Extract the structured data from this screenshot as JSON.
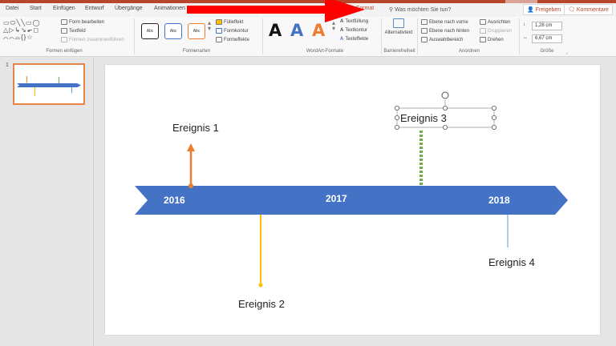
{
  "tabs": [
    {
      "label": "Datei",
      "active": false
    },
    {
      "label": "Start",
      "active": false
    },
    {
      "label": "Einfügen",
      "active": false
    },
    {
      "label": "Entwurf",
      "active": false
    },
    {
      "label": "Übergänge",
      "active": false
    },
    {
      "label": "Animationen",
      "active": false
    },
    {
      "label": "Format",
      "active": true
    }
  ],
  "search": {
    "placeholder": "Was möchten Sie tun?",
    "icon": "search-icon"
  },
  "share": {
    "label": "Freigeben",
    "icon": "share-icon"
  },
  "comments": {
    "label": "Kommentare",
    "icon": "comment-icon"
  },
  "ribbon": {
    "groups": {
      "insert_shapes": "Formen einfügen",
      "shape_styles": "Formenarten",
      "wordart": "WordArt-Formate",
      "accessibility": "Barrierefreiheit",
      "arrange": "Anordnen",
      "size": "Größe"
    },
    "insert_shapes": {
      "edit_shape": "Form bearbeiten",
      "textbox": "Textfeld",
      "merge_shapes": "Formen zusammenführen"
    },
    "shape_styles": {
      "fill": "Fülleffekt",
      "outline": "Formkontur",
      "effects": "Formeffekte",
      "style_label": "Abc"
    },
    "wordart": {
      "text_fill": "Textfüllung",
      "text_outline": "Textkontur",
      "text_effects": "Texteffekte",
      "letter": "A"
    },
    "accessibility": {
      "alt_text": "Alternativtext"
    },
    "arrange": {
      "bring_forward": "Ebene nach vorne",
      "send_backward": "Ebene nach hinten",
      "selection_pane": "Auswahlbereich",
      "align": "Ausrichten",
      "group": "Gruppieren",
      "rotate": "Drehen"
    },
    "size": {
      "height": "1,28 cm",
      "width": "6,67 cm"
    }
  },
  "thumbnail": {
    "number": "1"
  },
  "slide": {
    "years": [
      "2016",
      "2017",
      "2018"
    ],
    "events": [
      "Ereignis 1",
      "Ereignis 2",
      "Ereignis 3",
      "Ereignis 4"
    ]
  },
  "colors": {
    "accent": "#b7472a",
    "timeline_band": "#4472c4",
    "event1_line": "#ed7d31",
    "event2_line": "#ffc000",
    "event3_line": "#70ad47",
    "event4_line": "#5b9bd5",
    "annotation_arrow": "#ff0000",
    "selection_handle": "#7f7f7f"
  }
}
